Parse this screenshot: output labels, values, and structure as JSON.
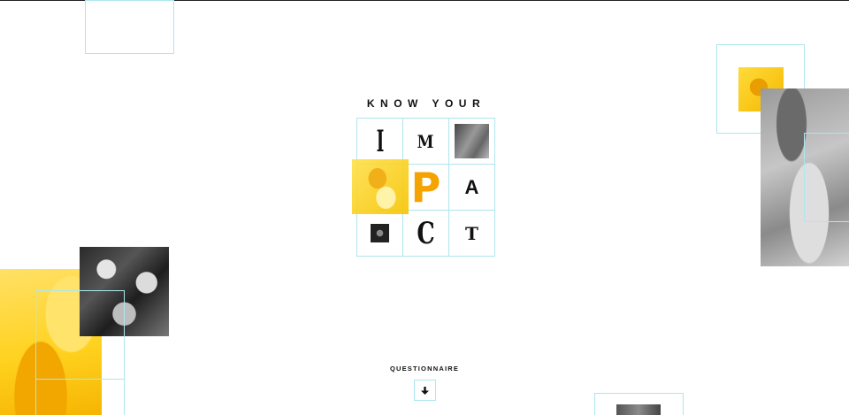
{
  "hero": {
    "kicker": "KNOW YOUR",
    "letters": {
      "i": "I",
      "m": "M",
      "p": "P",
      "a": "A",
      "c": "C",
      "t": "T"
    },
    "accent_color": "#f5a300"
  },
  "cta": {
    "label": "QUESTIONNAIRE",
    "icon": "arrow-down-icon"
  },
  "colors": {
    "outline": "#aee6ee",
    "yellow": "#ffd21f",
    "text": "#111111"
  }
}
